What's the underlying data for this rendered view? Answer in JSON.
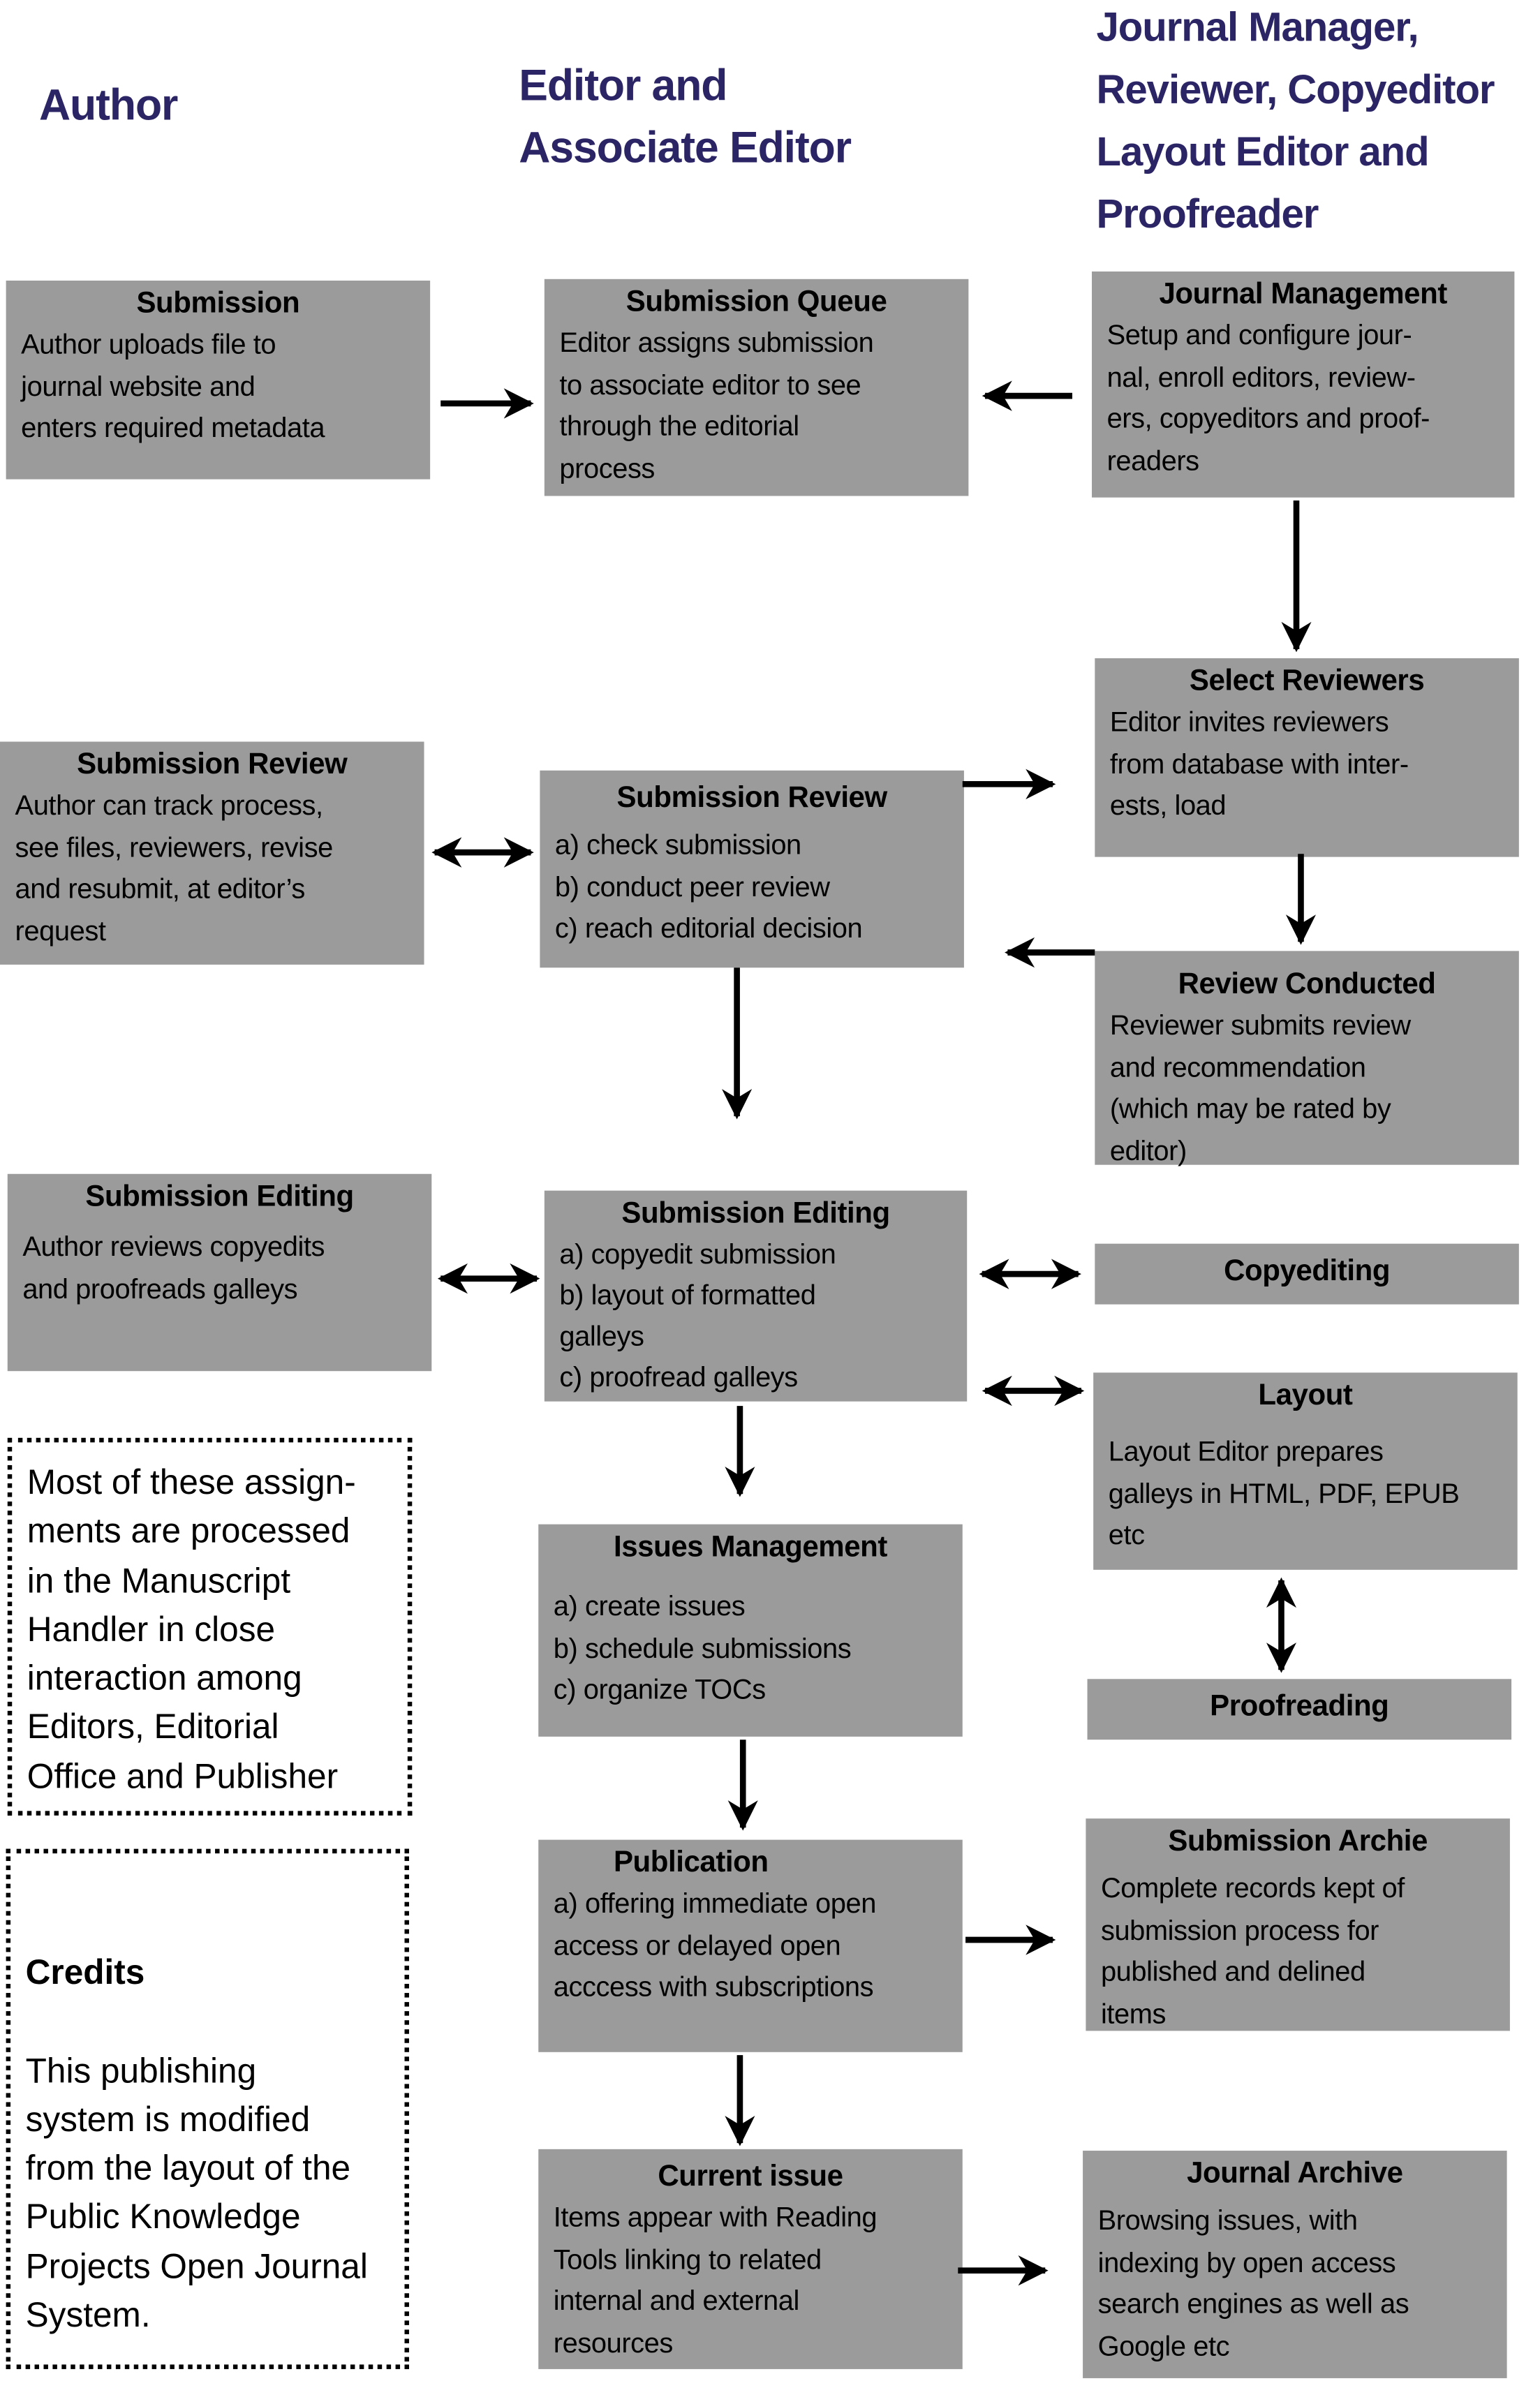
{
  "columns": {
    "author": "Author",
    "editor": "Editor and\nAssociate Editor",
    "manager": "Journal Manager,\nReviewer, Copyeditor\nLayout Editor and\nProofreader"
  },
  "boxes": {
    "submission": {
      "title": "Submission",
      "text": "Author uploads file to\njournal website and\nenters required metadata"
    },
    "queue": {
      "title": "Submission Queue",
      "text": "Editor assigns submission\nto associate editor to see\nthrough the editorial\nprocess"
    },
    "journal_mgmt": {
      "title": "Journal Management",
      "text": "Setup and configure jour-\nnal, enroll editors, review-\ners, copyeditors and proof-\nreaders"
    },
    "select_reviewers": {
      "title": "Select Reviewers",
      "text": "Editor invites reviewers\nfrom database with inter-\nests, load"
    },
    "author_review": {
      "title": "Submission Review",
      "text": "Author can track process,\nsee files, reviewers, revise\nand resubmit, at editor’s\nrequest"
    },
    "editor_review": {
      "title": "Submission Review",
      "text": "a) check submission\nb) conduct peer review\nc) reach editorial decision"
    },
    "review_conducted": {
      "title": "Review Conducted",
      "text": "Reviewer submits review\nand recommendation\n(which may be rated by\neditor)"
    },
    "author_editing": {
      "title": "Submission Editing",
      "text": "Author reviews copyedits\nand proofreads galleys"
    },
    "editor_editing": {
      "title": "Submission Editing",
      "text": "a) copyedit submission\nb) layout of formatted\ngalleys\nc) proofread galleys"
    },
    "copyediting": {
      "title": "Copyediting"
    },
    "layout": {
      "title": "Layout",
      "text": "Layout Editor prepares\ngalleys in HTML, PDF, EPUB\netc"
    },
    "proofreading": {
      "title": "Proofreading"
    },
    "issues": {
      "title": "Issues Management",
      "text": "a) create issues\nb) schedule submissions\nc) organize TOCs"
    },
    "publication": {
      "title": "Publication",
      "text": "a) offering immediate open\naccess or delayed open\nacccess with subscriptions"
    },
    "sub_archive": {
      "title": "Submission Archie",
      "text": "Complete records kept of\nsubmission process for\npublished and delined\nitems"
    },
    "current_issue": {
      "title": "Current issue",
      "text": "Items appear with Reading\nTools linking to related\ninternal and external\nresources"
    },
    "journal_archive": {
      "title": "Journal Archive",
      "text": "Browsing issues, with\nindexing by open access\nsearch engines as well as\nGoogle etc"
    }
  },
  "notes": {
    "manuscript": "Most of these assign-\nments are processed\nin the Manuscript\nHandler in close\ninteraction among\nEditors, Editorial\nOffice and Publisher",
    "credits_title": "Credits",
    "credits_text": "This publishing\nsystem is modified\nfrom the layout of the\nPublic Knowledge\nProjects Open Journal\nSystem."
  },
  "colors": {
    "box": "#9b9b9b",
    "header": "#2b2565",
    "arrow": "#000000"
  }
}
